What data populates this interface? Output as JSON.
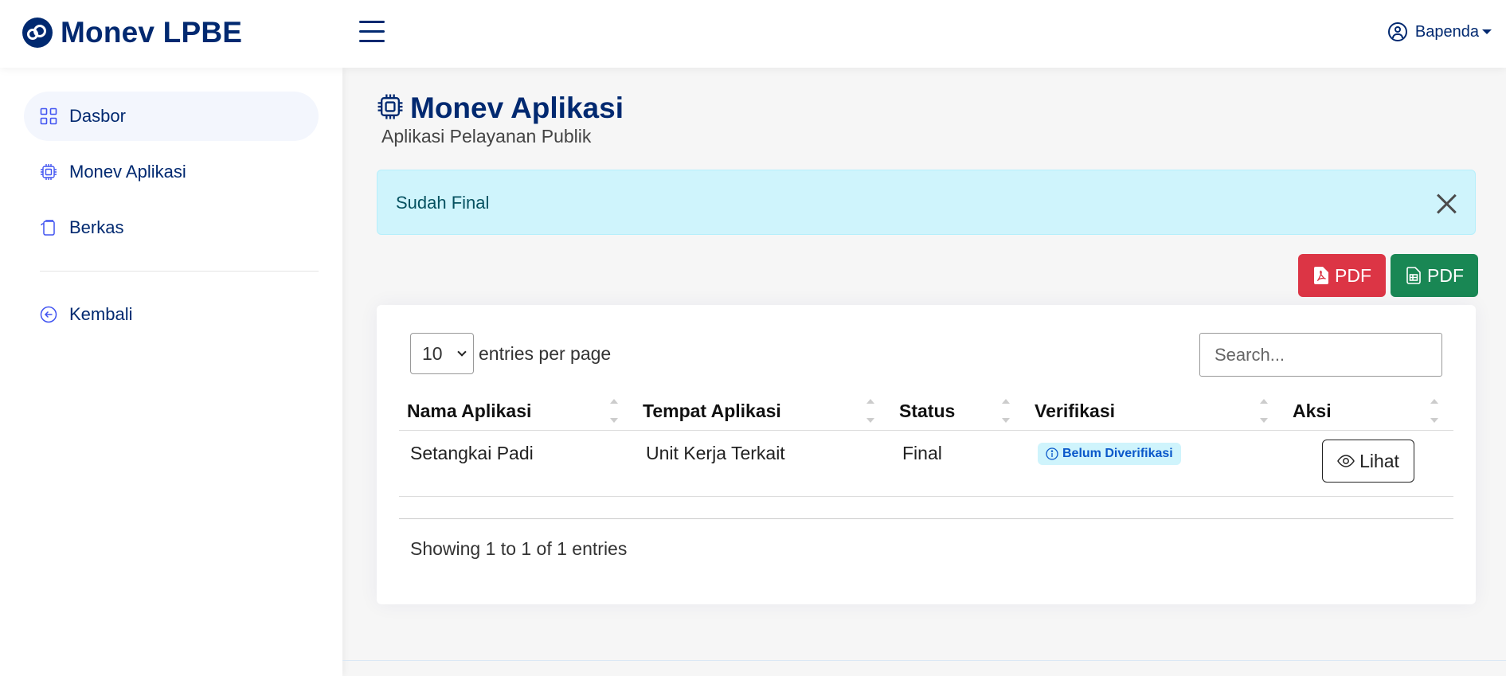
{
  "app": {
    "brand": "Monev LPBE"
  },
  "user": {
    "name": "Bapenda"
  },
  "sidebar": {
    "items": [
      {
        "label": "Dasbor"
      },
      {
        "label": "Monev Aplikasi"
      },
      {
        "label": "Berkas"
      },
      {
        "label": "Kembali"
      }
    ]
  },
  "page": {
    "title": "Monev Aplikasi",
    "subtitle": "Aplikasi Pelayanan Publik"
  },
  "alert": {
    "message": "Sudah Final"
  },
  "actions": {
    "pdf_label": "PDF",
    "excel_label": "PDF"
  },
  "table": {
    "per_page_value": "10",
    "per_page_label": "entries per page",
    "search_placeholder": "Search...",
    "headers": [
      "Nama Aplikasi",
      "Tempat Aplikasi",
      "Status",
      "Verifikasi",
      "Aksi"
    ],
    "rows": [
      {
        "nama": "Setangkai Padi",
        "tempat": "Unit Kerja Terkait",
        "status": "Final",
        "verifikasi": "Belum Diverifikasi",
        "aksi": "Lihat"
      }
    ],
    "info": "Showing 1 to 1 of 1 entries"
  },
  "colors": {
    "brand": "#012970",
    "alert_bg": "#cff4fc",
    "danger": "#dc3545",
    "success": "#198754"
  }
}
